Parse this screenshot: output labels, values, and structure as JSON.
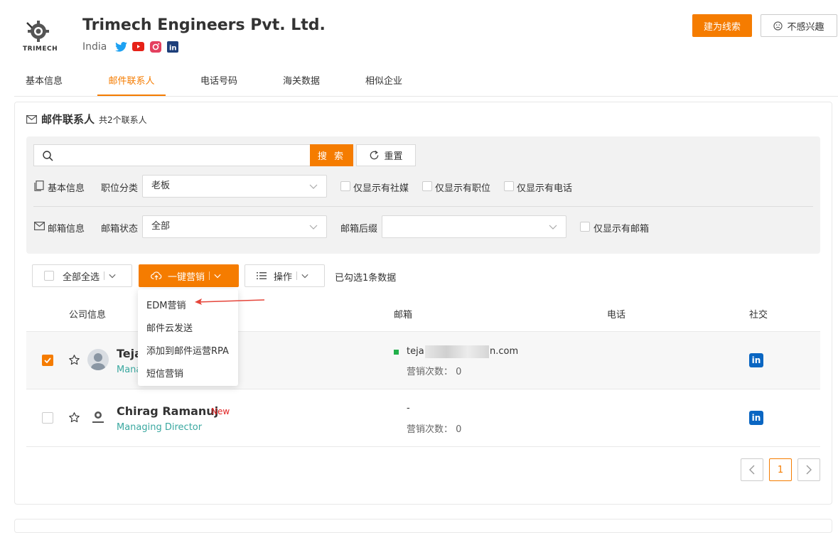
{
  "header": {
    "company_name": "Trimech Engineers Pvt. Ltd.",
    "country": "India",
    "logo_text": "TRIMECH",
    "social": [
      "twitter-icon",
      "youtube-icon",
      "instagram-icon",
      "linkedin-icon"
    ],
    "lead_button": "建为线索",
    "not_interested_button": "不感兴趣"
  },
  "tabs": [
    "基本信息",
    "邮件联系人",
    "电话号码",
    "海关数据",
    "相似企业"
  ],
  "active_tab": 1,
  "section": {
    "title": "邮件联系人",
    "count": "共2个联系人"
  },
  "filters": {
    "search_placeholder": "",
    "search_button": "搜 索",
    "reset_button": "重置",
    "basic_info_label": "基本信息",
    "position_label": "职位分类",
    "position_value": "老板",
    "only_social": "仅显示有社媒",
    "only_position": "仅显示有职位",
    "only_phone": "仅显示有电话",
    "email_info_label": "邮箱信息",
    "email_status_label": "邮箱状态",
    "email_status_value": "全部",
    "email_suffix_label": "邮箱后缀",
    "email_suffix_value": "",
    "only_email": "仅显示有邮箱"
  },
  "actions": {
    "select_all": "全部全选",
    "marketing": "一键营销",
    "operate": "操作",
    "selected_info": "已勾选1条数据"
  },
  "dropdown": [
    "EDM营销",
    "邮件云发送",
    "添加到邮件运营RPA",
    "短信营销"
  ],
  "table": {
    "headers": [
      "公司信息",
      "邮箱",
      "电话",
      "社交"
    ],
    "rows": [
      {
        "name": "Teja",
        "title": "Mana",
        "email": "teja",
        "email_suffix": "n.com",
        "marketing_count": "营销次数：  0",
        "checked": true,
        "badge": ""
      },
      {
        "name": "Chirag Ramanuj",
        "title": "Managing Director",
        "email": "-",
        "email_suffix": "",
        "marketing_count": "营销次数：  0",
        "checked": false,
        "badge": "New"
      }
    ]
  },
  "pagination": {
    "current": "1"
  },
  "colors": {
    "accent": "#f57c00",
    "link_teal": "#3aa8a0",
    "linkedin": "#0a66c2",
    "email_dot": "#22b04b"
  }
}
